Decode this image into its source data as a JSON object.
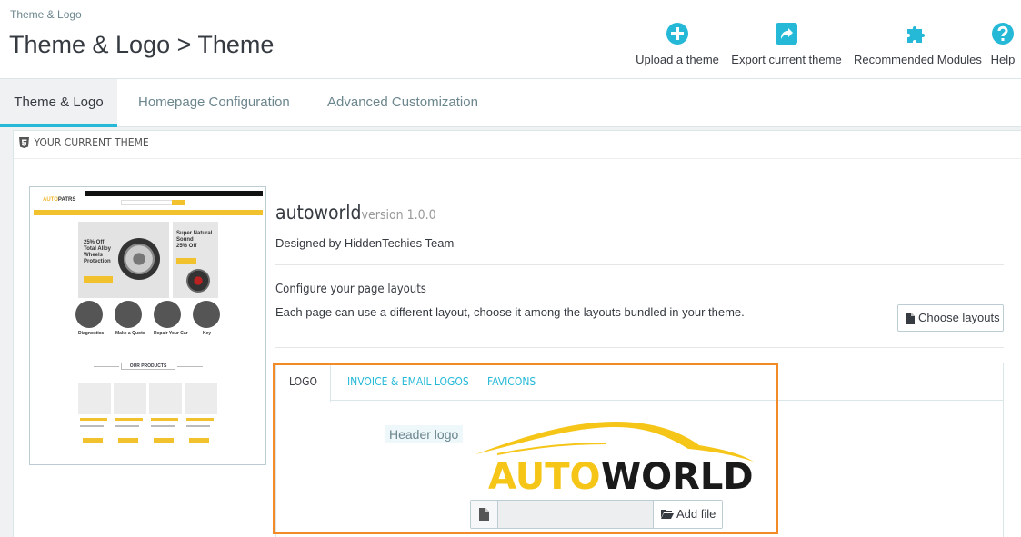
{
  "header": {
    "breadcrumb": "Theme & Logo",
    "title": "Theme & Logo > Theme",
    "toolbar": [
      {
        "label": "Upload a theme",
        "icon": "plus-circle-icon"
      },
      {
        "label": "Export current theme",
        "icon": "share-icon"
      },
      {
        "label": "Recommended Modules",
        "icon": "puzzle-icon"
      },
      {
        "label": "Help",
        "icon": "question-circle-icon"
      }
    ]
  },
  "tabs": [
    {
      "label": "Theme & Logo",
      "active": true
    },
    {
      "label": "Homepage Configuration",
      "active": false
    },
    {
      "label": "Advanced Customization",
      "active": false
    }
  ],
  "panel": {
    "heading": "YOUR CURRENT THEME",
    "preview": {
      "logo": "AUTOPATRS",
      "banner_text": "25% Off Total Alloy Wheels Protection",
      "banner2_text": "Super Natural Sound 25% Off",
      "services": [
        "Diagnostics",
        "Make a Quote",
        "Repair Your Car",
        "Key"
      ],
      "products_heading": "OUR PRODUCTS"
    },
    "theme": {
      "name": "autoworld",
      "version": "version 1.0.0",
      "author": "Designed by HiddenTechies Team"
    },
    "layouts": {
      "title": "Configure your page layouts",
      "description": "Each page can use a different layout, choose it among the layouts bundled in your theme.",
      "button": "Choose layouts"
    },
    "logo_tabs": [
      {
        "label": "LOGO",
        "active": true
      },
      {
        "label": "INVOICE & EMAIL LOGOS",
        "active": false
      },
      {
        "label": "FAVICONS",
        "active": false
      }
    ],
    "header_logo_label": "Header logo",
    "logo_text": "AUTOWORLD",
    "file_input": {
      "value": "",
      "button": "Add file"
    }
  },
  "colors": {
    "accent": "#25b9d7",
    "highlight": "#f28a27",
    "logo_yellow": "#f5c518"
  }
}
